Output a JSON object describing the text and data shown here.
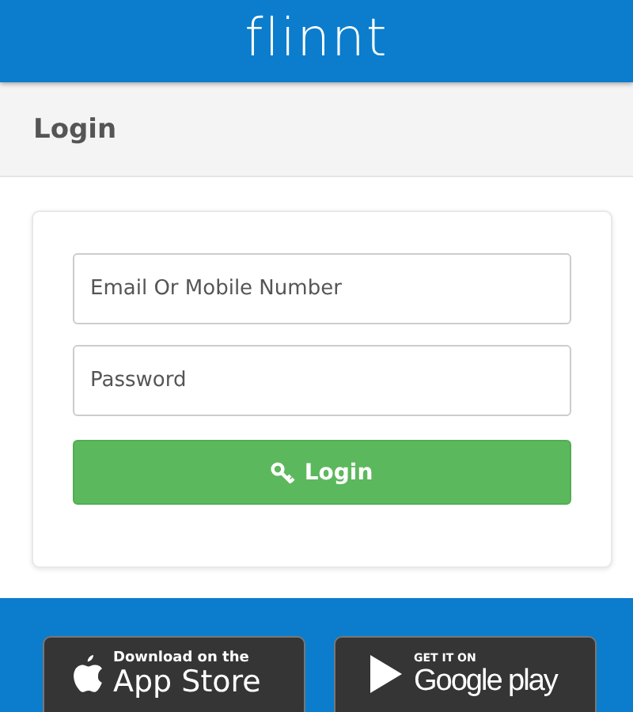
{
  "header": {
    "logo": "flinnt"
  },
  "panel": {
    "title": "Login"
  },
  "form": {
    "fields": [
      {
        "placeholder": "Email Or Mobile Number"
      },
      {
        "placeholder": "Password"
      }
    ],
    "submit": "Login"
  },
  "badges": [
    {
      "kind": "apple",
      "small": "Download on the",
      "big": "App Store"
    },
    {
      "kind": "google",
      "small": "GET IT ON",
      "big": "Google play"
    }
  ]
}
